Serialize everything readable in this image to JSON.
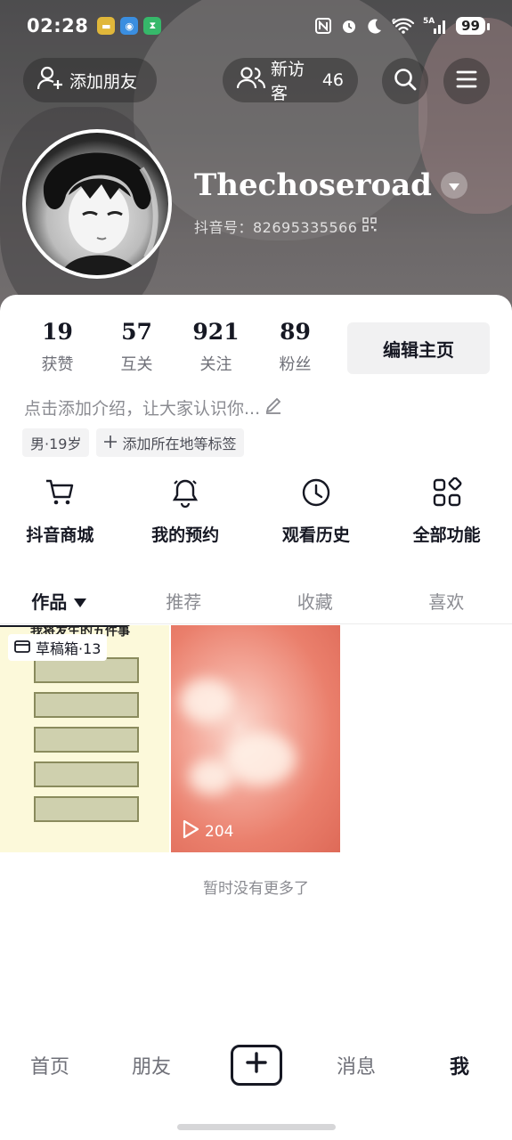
{
  "status_bar": {
    "time": "02:28",
    "network": "5A",
    "wifi_label": "6",
    "battery": "99"
  },
  "header": {
    "add_friend_label": "添加朋友",
    "visitors_label": "新访客",
    "visitors_count": "46"
  },
  "profile": {
    "nickname": "Thechoseroad",
    "douyin_id": "抖音号：82695335566"
  },
  "stats": [
    {
      "value": "19",
      "label": "获赞"
    },
    {
      "value": "57",
      "label": "互关"
    },
    {
      "value": "921",
      "label": "关注"
    },
    {
      "value": "89",
      "label": "粉丝"
    }
  ],
  "edit_profile_label": "编辑主页",
  "bio_placeholder": "点击添加介绍，让大家认识你...",
  "tags": {
    "gender_age": "男·19岁",
    "add_location": "添加所在地等标签"
  },
  "features": [
    {
      "label": "抖音商城",
      "icon": "cart-icon"
    },
    {
      "label": "我的预约",
      "icon": "bell-icon"
    },
    {
      "label": "观看历史",
      "icon": "clock-icon"
    },
    {
      "label": "全部功能",
      "icon": "grid-icon"
    }
  ],
  "tabs": [
    {
      "label": "作品"
    },
    {
      "label": "推荐"
    },
    {
      "label": "收藏"
    },
    {
      "label": "喜欢"
    }
  ],
  "grid": {
    "draft_badge": "草稿箱·13",
    "draft_headline": "我将发生的五件事",
    "video_plays": "204"
  },
  "no_more_text": "暂时没有更多了",
  "bottom_nav": {
    "home": "首页",
    "friends": "朋友",
    "messages": "消息",
    "me": "我"
  },
  "colors": {
    "primary_text": "#161823",
    "secondary_text": "#8a8b91",
    "button_bg": "#f1f1f2"
  }
}
